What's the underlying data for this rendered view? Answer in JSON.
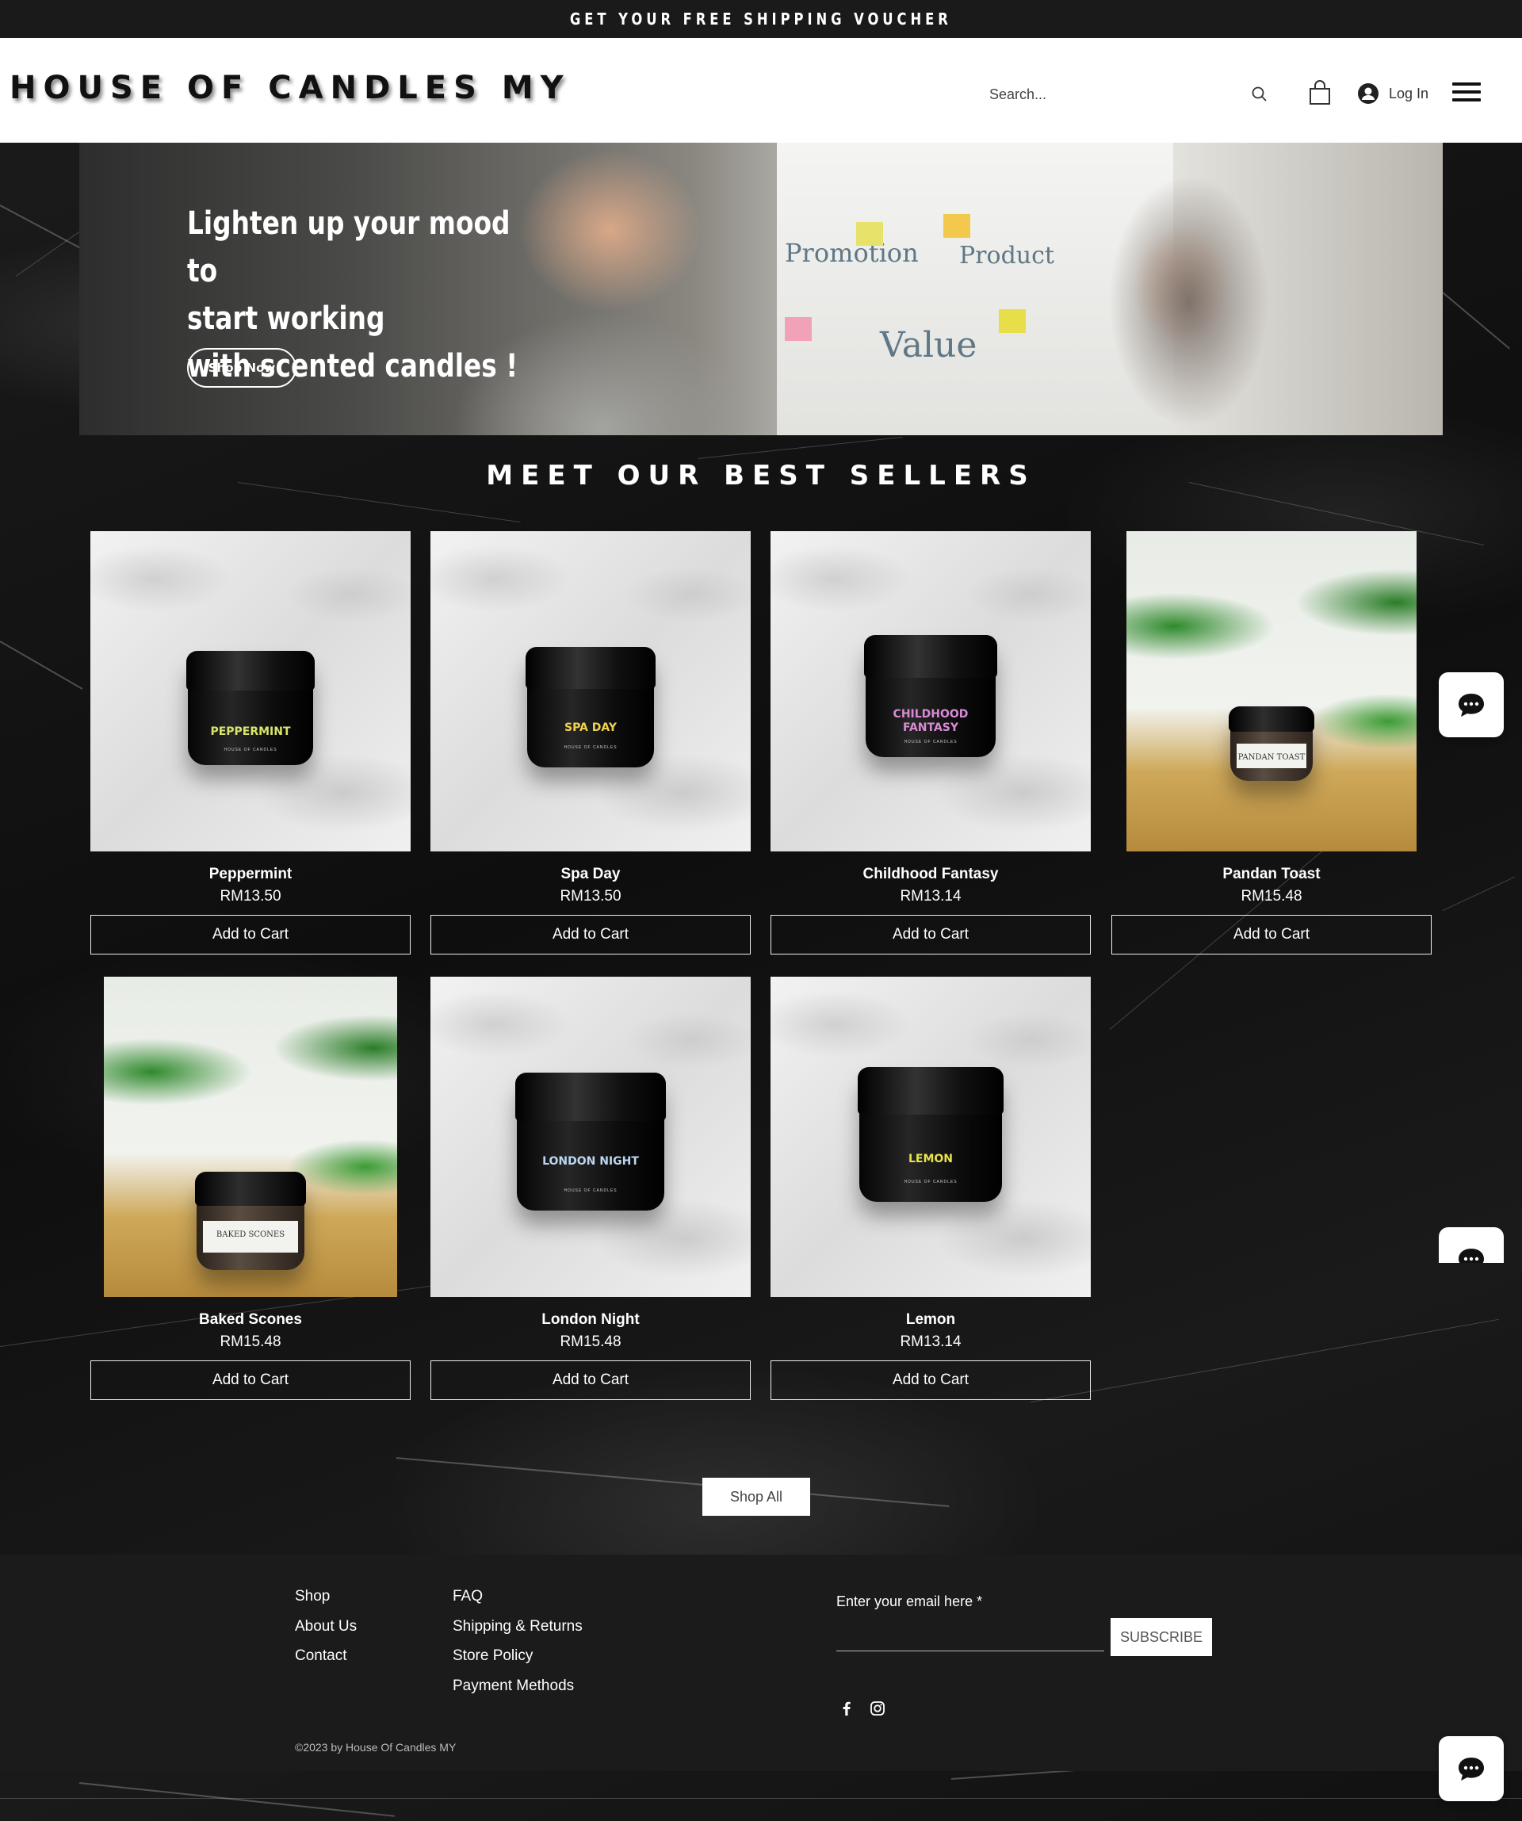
{
  "announcement": {
    "text": "GET YOUR FREE SHIPPING VOUCHER"
  },
  "header": {
    "logo": "HOUSE OF CANDLES MY",
    "search_placeholder": "Search...",
    "login_label": "Log In"
  },
  "hero": {
    "title": "Lighten up your mood to\nstart working\nwith scented candles !",
    "button_label": "Shop Now",
    "board_words": [
      "Promotion",
      "Product",
      "Value"
    ]
  },
  "best_sellers": {
    "title": "MEET OUR BEST SELLERS",
    "add_to_cart_label": "Add to Cart",
    "products": [
      {
        "name": "Peppermint",
        "price": "RM13.50",
        "jar_label": "PEPPERMINT",
        "label_color": "#d9e56a"
      },
      {
        "name": "Spa Day",
        "price": "RM13.50",
        "jar_label": "SPA DAY",
        "label_color": "#f0d34a"
      },
      {
        "name": "Childhood Fantasy",
        "price": "RM13.14",
        "jar_label": "CHILDHOOD FANTASY",
        "label_color": "#d98ad6"
      },
      {
        "name": "Pandan Toast",
        "price": "RM15.48",
        "jar_label": "PANDAN TOAST",
        "label_color": "#333333"
      },
      {
        "name": "Baked Scones",
        "price": "RM15.48",
        "jar_label": "BAKED SCONES",
        "label_color": "#333333"
      },
      {
        "name": "London Night",
        "price": "RM15.48",
        "jar_label": "LONDON NIGHT",
        "label_color": "#bcd6f2"
      },
      {
        "name": "Lemon",
        "price": "RM13.14",
        "jar_label": "LEMON",
        "label_color": "#e9e24a"
      }
    ],
    "jar_brand": "HOUSE OF CANDLES",
    "shop_all_label": "Shop All"
  },
  "footer": {
    "col1": [
      "Shop",
      "About Us",
      "Contact"
    ],
    "col2": [
      "FAQ",
      "Shipping & Returns",
      "Store Policy",
      "Payment Methods"
    ],
    "email_label": "Enter your email here *",
    "subscribe_label": "SUBSCRIBE",
    "copyright": "©2023 by House Of Candles MY"
  },
  "icons": [
    "search-icon",
    "cart-icon",
    "user-icon",
    "menu-icon",
    "chat-icon",
    "facebook-icon",
    "instagram-icon"
  ],
  "colors": {
    "dark": "#141414",
    "white": "#ffffff",
    "footer": "#1b1b1b"
  }
}
